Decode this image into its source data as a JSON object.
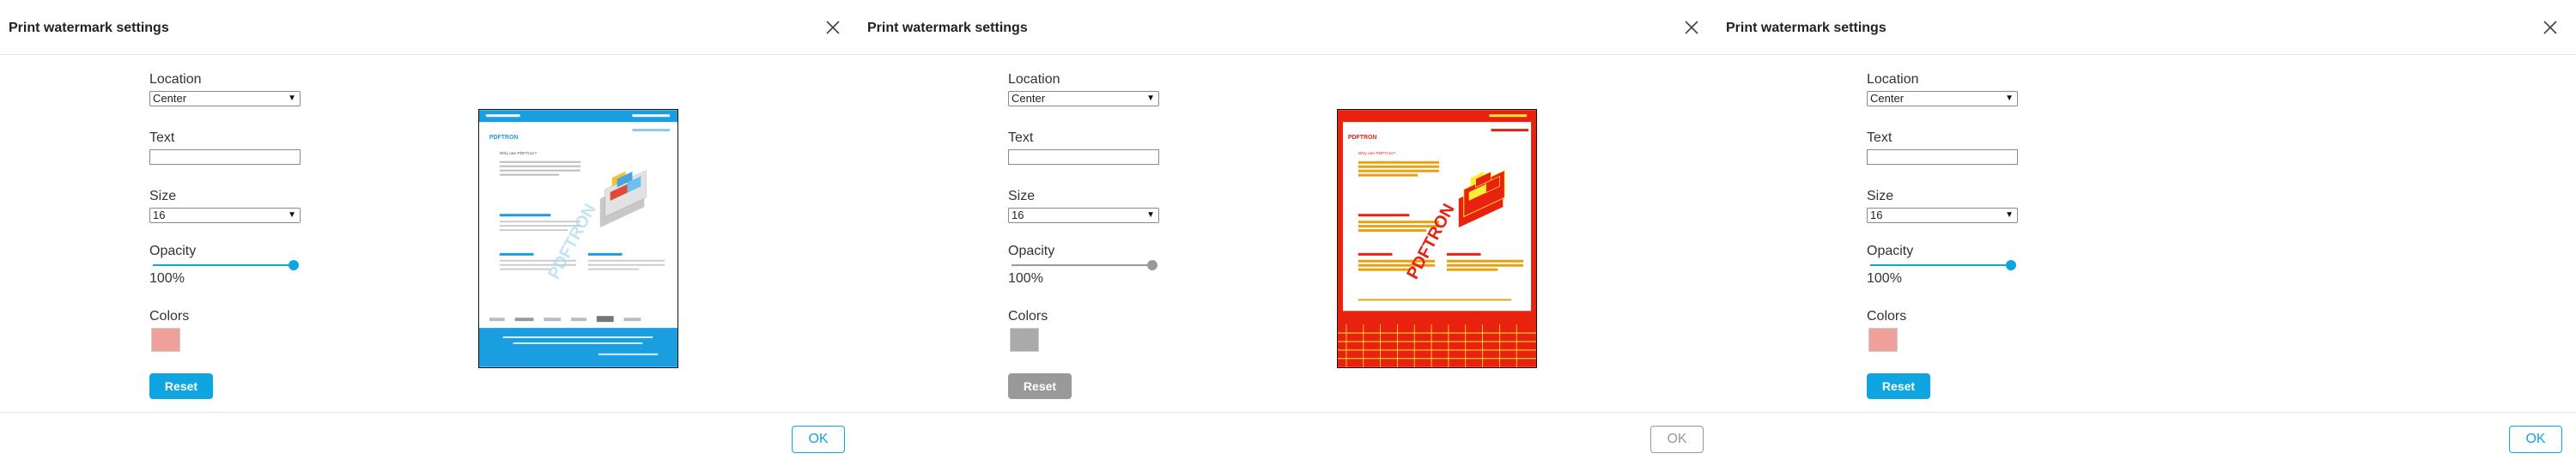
{
  "dialog": {
    "title": "Print watermark settings",
    "location_label": "Location",
    "location_value": "Center",
    "text_label": "Text",
    "text_value": "",
    "size_label": "Size",
    "size_value": "16",
    "opacity_label": "Opacity",
    "opacity_value": "100%",
    "opacity_fraction": 1.0,
    "colors_label": "Colors",
    "selected_color": "#f0a09a",
    "reset_label": "Reset",
    "ok_label": "OK"
  },
  "preview_doc": {
    "brand": "PDFTRON",
    "heading": "Why use PDFTron?",
    "watermark": "PDFTRON"
  },
  "colors": {
    "accent": "#0ea5e0",
    "preview_alt": "#e8220f",
    "preview_alt_text": "#ffee33"
  }
}
